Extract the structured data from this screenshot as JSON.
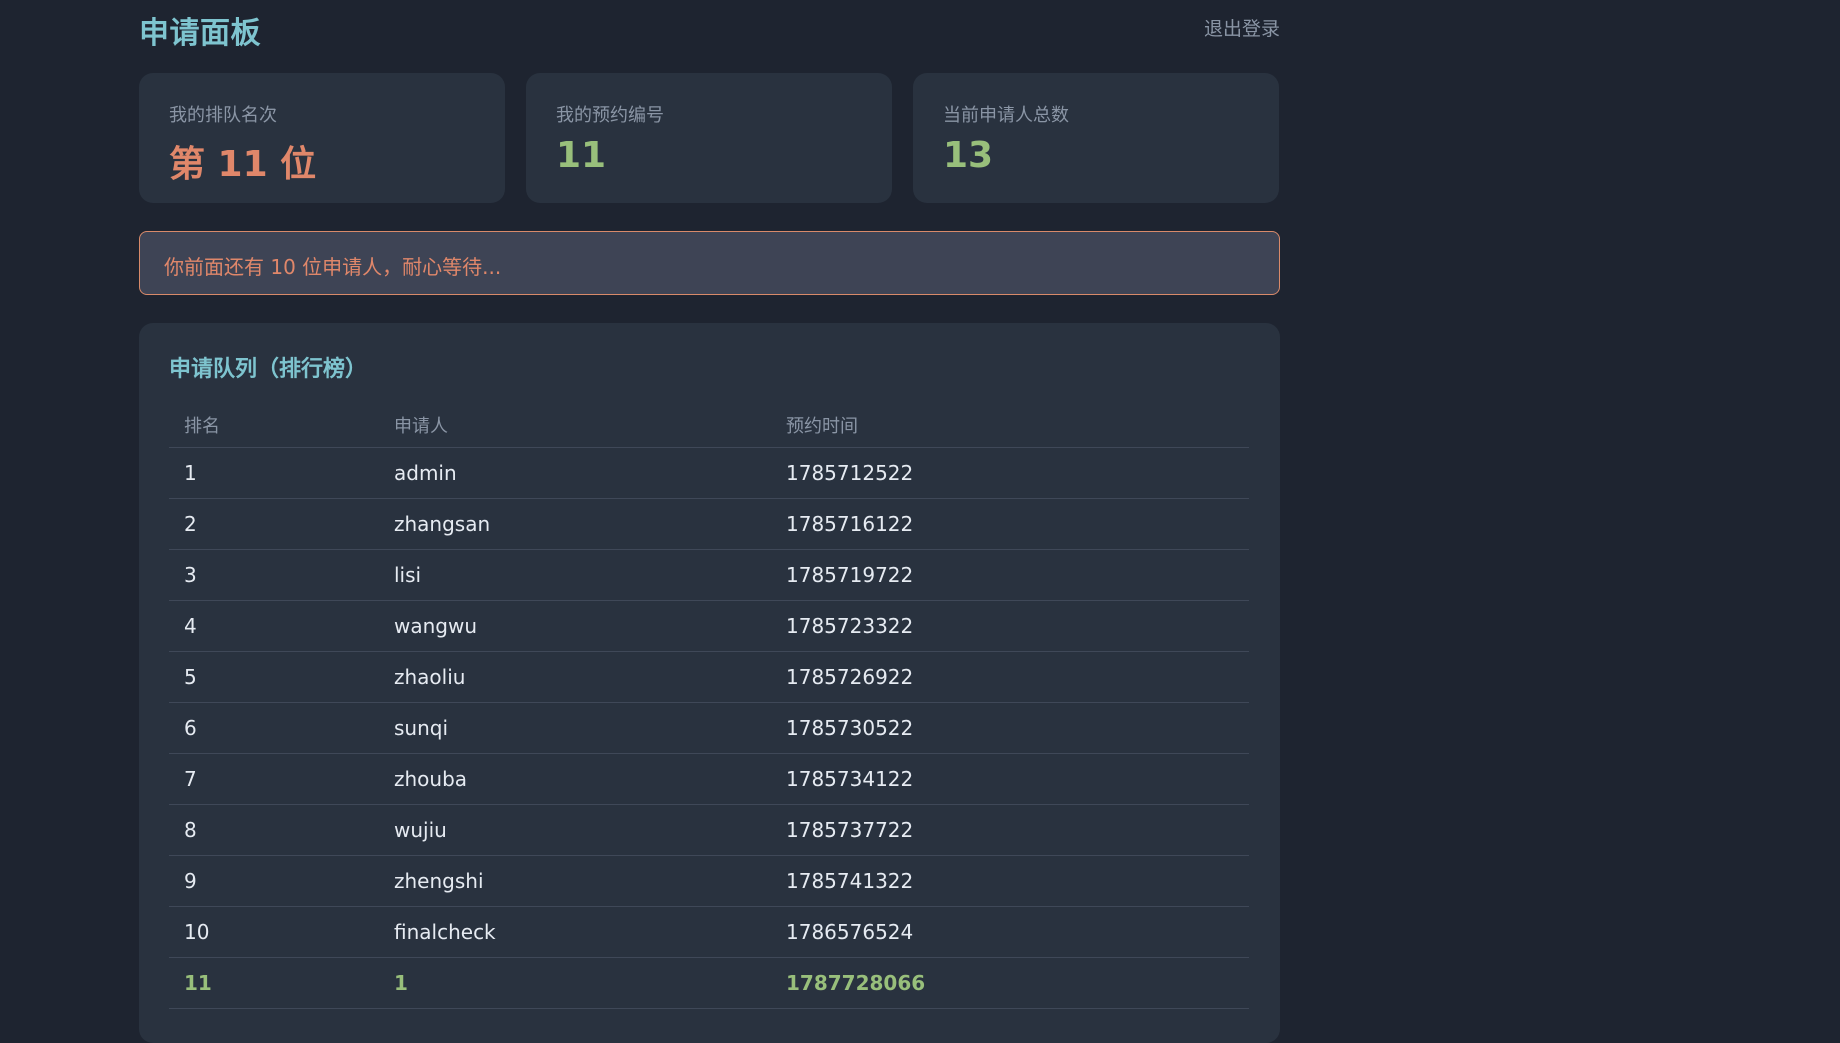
{
  "header": {
    "title": "申请面板",
    "logout_label": "退出登录"
  },
  "cards": [
    {
      "label": "我的排队名次",
      "value": "第 11 位",
      "color": "#e0876a"
    },
    {
      "label": "我的预约编号",
      "value": "11",
      "color": "#98bf7b"
    },
    {
      "label": "当前申请人总数",
      "value": "13",
      "color": "#98bf7b"
    }
  ],
  "notice": "你前面还有 10 位申请人，耐心等待...",
  "queue": {
    "title": "申请队列（排行榜）",
    "columns": [
      "排名",
      "申请人",
      "预约时间"
    ],
    "rows": [
      [
        "1",
        "admin",
        "1785712522"
      ],
      [
        "2",
        "zhangsan",
        "1785716122"
      ],
      [
        "3",
        "lisi",
        "1785719722"
      ],
      [
        "4",
        "wangwu",
        "1785723322"
      ],
      [
        "5",
        "zhaoliu",
        "1785726922"
      ],
      [
        "6",
        "sunqi",
        "1785730522"
      ],
      [
        "7",
        "zhouba",
        "1785734122"
      ],
      [
        "8",
        "wujiu",
        "1785737722"
      ],
      [
        "9",
        "zhengshi",
        "1785741322"
      ],
      [
        "10",
        "finalcheck",
        "1786576524"
      ],
      [
        "11",
        "1",
        "1787728066"
      ]
    ],
    "highlight_rank": "11"
  },
  "colors": {
    "accent": "#7ec4cf",
    "warning": "#e0876a",
    "success": "#98bf7b",
    "background": "#1e2430",
    "panel": "#29323f"
  }
}
